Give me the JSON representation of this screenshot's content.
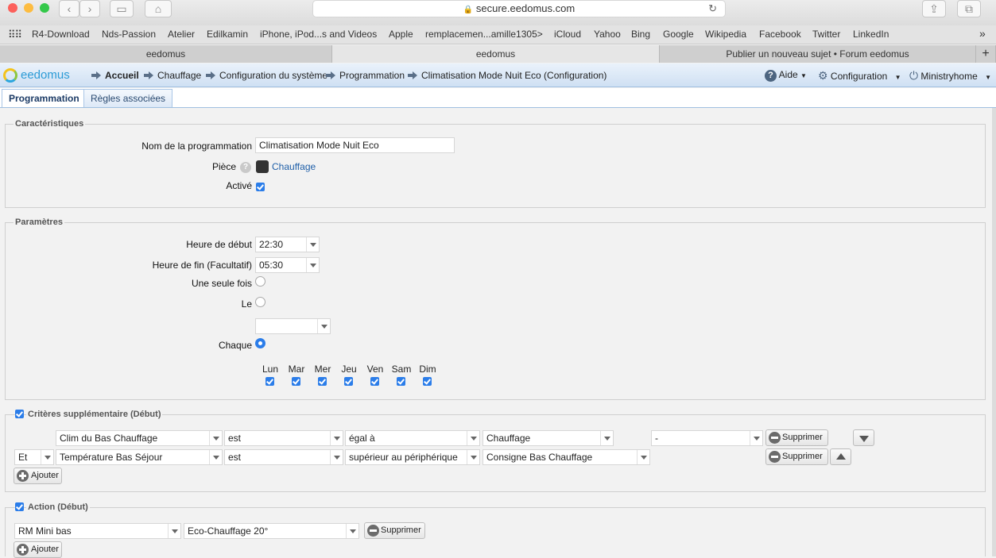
{
  "browser": {
    "url": "secure.eedomus.com",
    "bookmarks": [
      "R4-Download",
      "Nds-Passion",
      "Atelier",
      "Edilkamin",
      "iPhone, iPod...s and Videos",
      "Apple",
      "remplacemen...amille1305>",
      "iCloud",
      "Yahoo",
      "Bing",
      "Google",
      "Wikipedia",
      "Facebook",
      "Twitter",
      "LinkedIn"
    ],
    "tabs": [
      "eedomus",
      "eedomus",
      "Publier un nouveau sujet • Forum eedomus"
    ],
    "more_icon": "»"
  },
  "app": {
    "logo": "eedomus",
    "breadcrumbs": [
      "Accueil",
      "Chauffage",
      "Configuration du système",
      "Programmation",
      "Climatisation Mode Nuit Eco (Configuration)"
    ],
    "menu": {
      "help": "Aide",
      "config": "Configuration",
      "user": "Ministryhome"
    },
    "tabs": [
      "Programmation",
      "Règles associées"
    ]
  },
  "characteristics": {
    "legend": "Caractéristiques",
    "name_label": "Nom de la programmation",
    "name_value": "Climatisation Mode Nuit Eco",
    "room_label": "Pièce",
    "room_value": "Chauffage",
    "active_label": "Activé",
    "active": true
  },
  "parameters": {
    "legend": "Paramètres",
    "start_label": "Heure de début",
    "start_value": "22:30",
    "end_label": "Heure de fin (Facultatif)",
    "end_value": "05:30",
    "once_label": "Une seule fois",
    "on_label": "Le",
    "date_value": "",
    "each_label": "Chaque",
    "days": [
      "Lun",
      "Mar",
      "Mer",
      "Jeu",
      "Ven",
      "Sam",
      "Dim"
    ]
  },
  "criteria": {
    "legend": "Critères supplémentaire (Début)",
    "rows": [
      {
        "conj": "",
        "device": "Clim du Bas Chauffage",
        "state": "est",
        "op": "égal à",
        "value": "Chauffage",
        "extra": "-"
      },
      {
        "conj": "Et",
        "device": "Température Bas Séjour",
        "state": "est",
        "op": "supérieur au périphérique",
        "value": "Consigne Bas Chauffage",
        "extra": ""
      }
    ],
    "delete_label": "Supprimer",
    "add_label": "Ajouter"
  },
  "action": {
    "legend": "Action (Début)",
    "device": "RM Mini bas",
    "value": "Eco-Chauffage 20°",
    "delete_label": "Supprimer",
    "add_label": "Ajouter"
  }
}
